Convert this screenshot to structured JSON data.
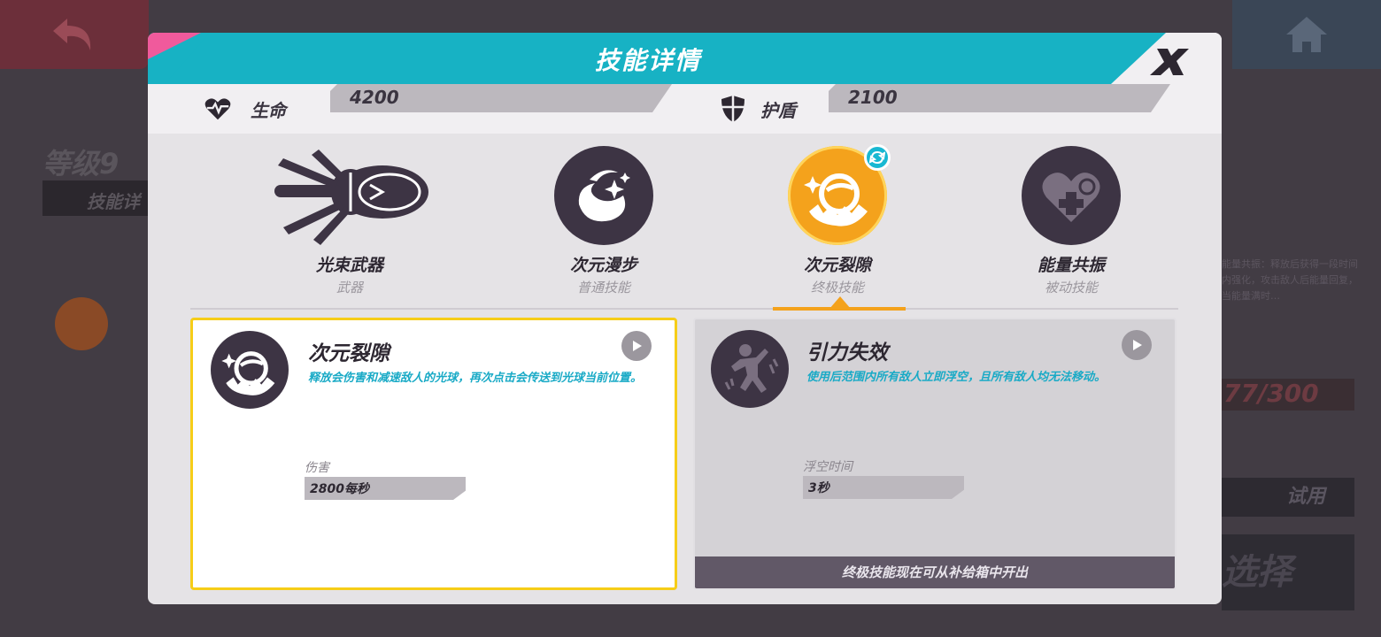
{
  "background": {
    "level": "等级9",
    "skill_tab": "技能详",
    "right_text": "能量共振：释放后获得一段时间内强化，攻击敌人后能量回复，当能量满时…",
    "progress": "77/300",
    "try_button": "试用",
    "select_button": "选择"
  },
  "modal": {
    "title": "技能详情",
    "close_label": "X",
    "stats": {
      "hp_label": "生命",
      "hp_value": "4200",
      "shield_label": "护盾",
      "shield_value": "2100"
    },
    "skills": [
      {
        "name": "光束武器",
        "type": "武器",
        "icon": "spider-gauntlet-icon"
      },
      {
        "name": "次元漫步",
        "type": "普通技能",
        "icon": "swirl-sparkle-icon"
      },
      {
        "name": "次元裂隙",
        "type": "终极技能",
        "icon": "rift-orb-icon",
        "selected": true
      },
      {
        "name": "能量共振",
        "type": "被动技能",
        "icon": "heart-plus-icon"
      }
    ],
    "cards": [
      {
        "title": "次元裂隙",
        "description": "释放会伤害和减速敌人的光球，再次点击会传送到光球当前位置。",
        "stat_label": "伤害",
        "stat_value": "2800每秒"
      },
      {
        "title": "引力失效",
        "description": "使用后范围内所有敌人立即浮空，且所有敌人均无法移动。",
        "stat_label": "浮空时间",
        "stat_value": "3秒",
        "footer": "终极技能现在可从补给箱中开出"
      }
    ]
  },
  "colors": {
    "banner": "#17b2c4",
    "accent_pink": "#f05a9c",
    "selected_orange": "#f4a21c",
    "selected_border": "#f6cd18",
    "desc_text": "#19aac6"
  }
}
